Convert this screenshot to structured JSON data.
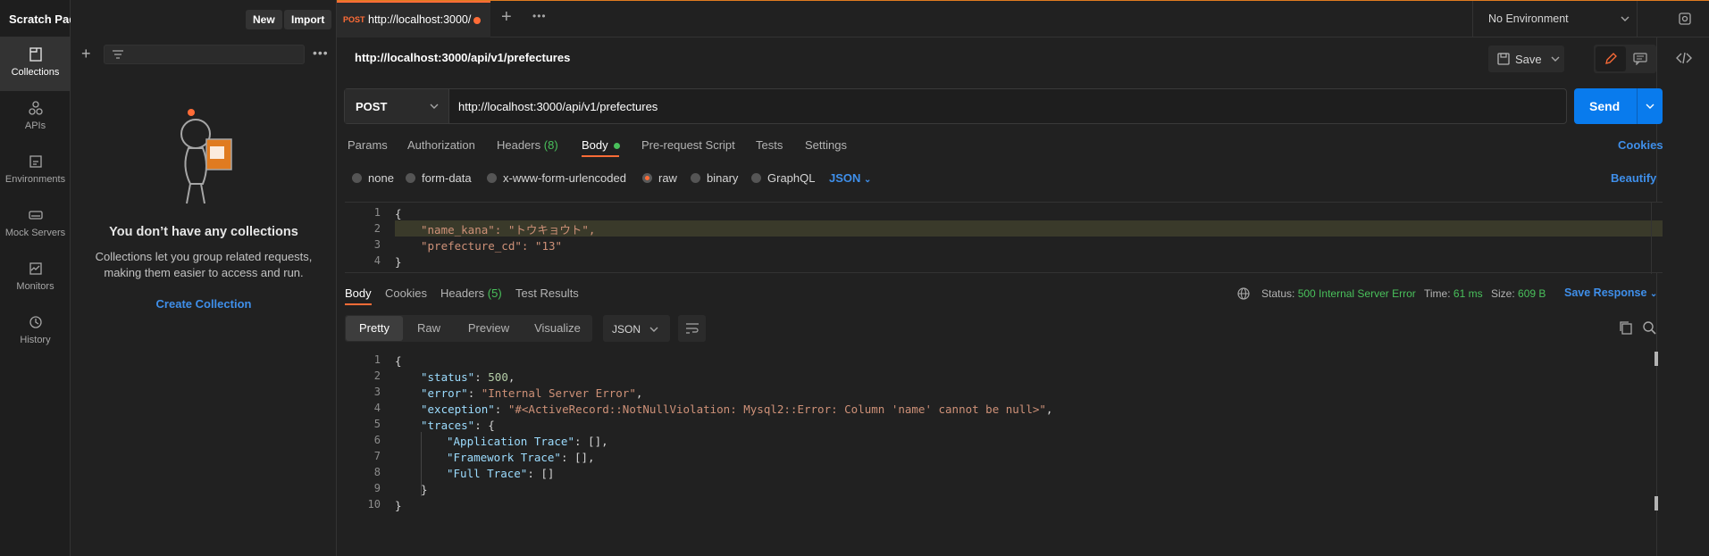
{
  "sidebar": {
    "title": "Scratch Pad",
    "new_label": "New",
    "import_label": "Import",
    "rail": [
      {
        "label": "Collections",
        "icon": "collections-icon"
      },
      {
        "label": "APIs",
        "icon": "apis-icon"
      },
      {
        "label": "Environments",
        "icon": "environments-icon"
      },
      {
        "label": "Mock Servers",
        "icon": "mock-servers-icon"
      },
      {
        "label": "Monitors",
        "icon": "monitors-icon"
      },
      {
        "label": "History",
        "icon": "history-icon"
      }
    ],
    "empty_title": "You don’t have any collections",
    "empty_desc_1": "Collections let you group related requests,",
    "empty_desc_2": "making them easier to access and run.",
    "create_label": "Create Collection"
  },
  "tabs": {
    "method_badge": "POST",
    "tab_title": "http://localhost:3000/",
    "environment": "No Environment"
  },
  "request": {
    "name": "http://localhost:3000/api/v1/prefectures",
    "save_label": "Save",
    "method": "POST",
    "url": "http://localhost:3000/api/v1/prefectures",
    "send_label": "Send",
    "tabs": [
      "Params",
      "Authorization",
      "Headers",
      "Body",
      "Pre-request Script",
      "Tests",
      "Settings"
    ],
    "headers_count": "(8)",
    "cookies_label": "Cookies",
    "body_modes": [
      "none",
      "form-data",
      "x-www-form-urlencoded",
      "raw",
      "binary",
      "GraphQL"
    ],
    "body_format": "JSON",
    "beautify_label": "Beautify",
    "body_lines": [
      "{",
      "\"name_kana\": \"トウキョウト\",",
      "\"prefecture_cd\": \"13\"",
      "}"
    ]
  },
  "response": {
    "tabs": [
      "Body",
      "Cookies",
      "Headers",
      "Test Results"
    ],
    "headers_count": "(5)",
    "status_label": "Status:",
    "status_value": "500 Internal Server Error",
    "time_label": "Time:",
    "time_value": "61 ms",
    "size_label": "Size:",
    "size_value": "609 B",
    "save_response_label": "Save Response",
    "views": [
      "Pretty",
      "Raw",
      "Preview",
      "Visualize"
    ],
    "format": "JSON",
    "colors": {
      "ok": "#49c05b",
      "link": "#3f8fea",
      "accent": "#ff6c37",
      "send": "#097bed"
    }
  }
}
